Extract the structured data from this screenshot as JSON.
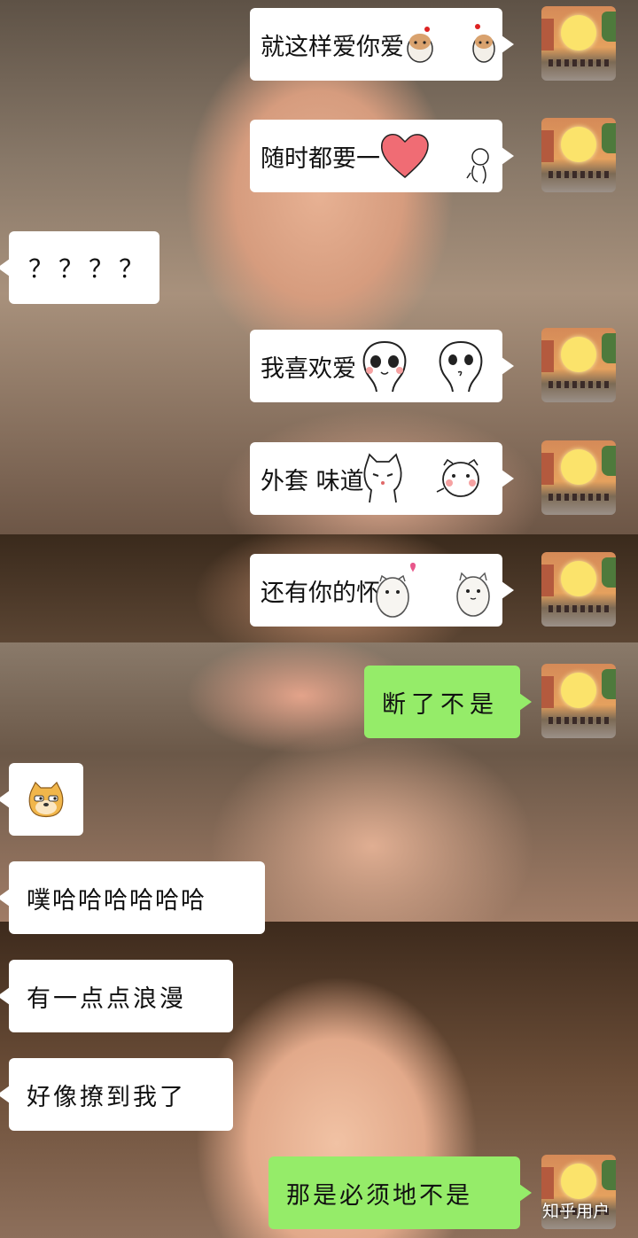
{
  "colors": {
    "bubble_white": "#ffffff",
    "bubble_green": "#95ec69"
  },
  "messages": [
    {
      "side": "right",
      "text": "就这样爱你爱",
      "stickers": [
        "hamster-sticker",
        "hamster-sticker"
      ]
    },
    {
      "side": "right",
      "text": "随时都要一",
      "stickers": [
        "heart-sticker",
        "doodle-sticker"
      ]
    },
    {
      "side": "left",
      "text": "？？？？"
    },
    {
      "side": "right",
      "text": "我喜欢爱",
      "stickers": [
        "blush-face-sticker",
        "blush-face-sticker"
      ]
    },
    {
      "side": "right",
      "text": "外套 味道",
      "stickers": [
        "cat-sticker",
        "hamster-sticker"
      ]
    },
    {
      "side": "right",
      "text": "还有你的怀",
      "stickers": [
        "hamster-heart-sticker",
        "hamster-sticker"
      ]
    },
    {
      "side": "right",
      "text": "断了不是"
    },
    {
      "side": "left",
      "text": "",
      "stickers": [
        "doge-emoji"
      ]
    },
    {
      "side": "left",
      "text": "噗哈哈哈哈哈哈"
    },
    {
      "side": "left",
      "text": "有一点点浪漫"
    },
    {
      "side": "left",
      "text": "好像撩到我了"
    },
    {
      "side": "right",
      "text": "那是必须地不是"
    }
  ],
  "watermark": {
    "icon": "zhihu-logo",
    "text": "知乎用户"
  }
}
